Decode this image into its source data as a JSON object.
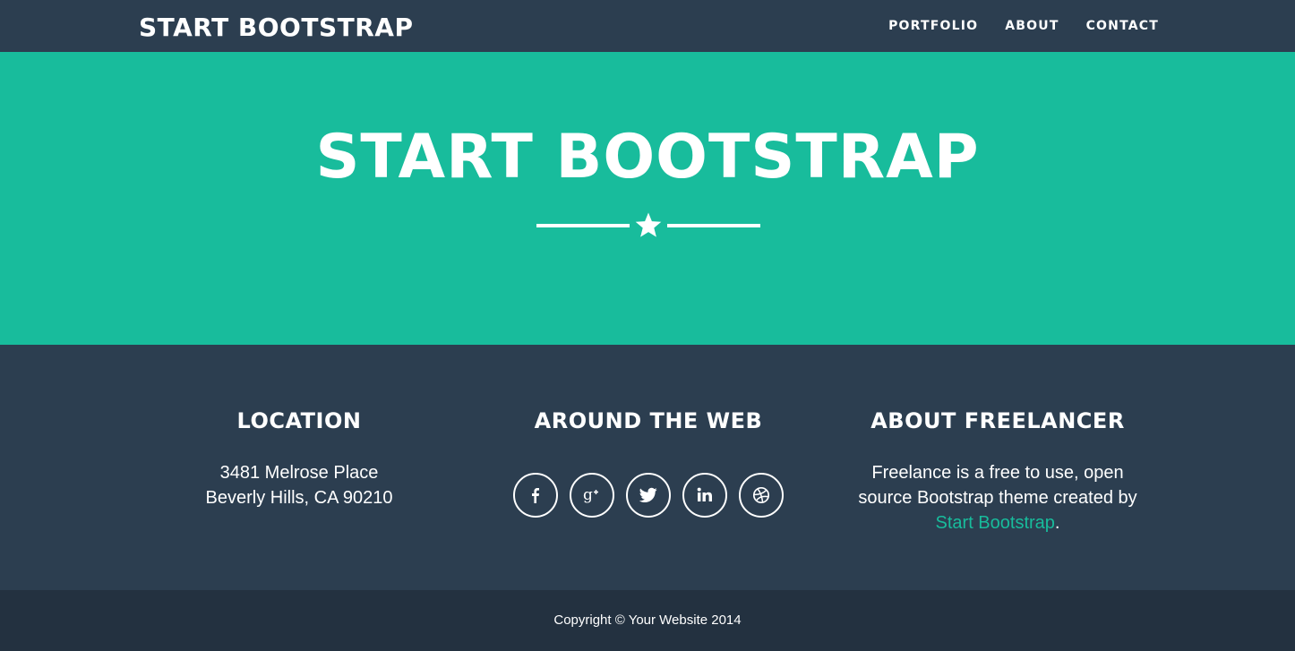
{
  "navbar": {
    "brand": "START BOOTSTRAP",
    "links": [
      "PORTFOLIO",
      "ABOUT",
      "CONTACT"
    ]
  },
  "hero": {
    "title": "START BOOTSTRAP",
    "divider_icon": "star-icon"
  },
  "footer": {
    "location": {
      "heading": "LOCATION",
      "line1": "3481 Melrose Place",
      "line2": "Beverly Hills, CA 90210"
    },
    "web": {
      "heading": "AROUND THE WEB",
      "icons": [
        "facebook-icon",
        "google-plus-icon",
        "twitter-icon",
        "linkedin-icon",
        "dribbble-icon"
      ]
    },
    "about": {
      "heading": "ABOUT FREELANCER",
      "text": "Freelance is a free to use, open source Bootstrap theme created by ",
      "link_text": "Start Bootstrap",
      "suffix": "."
    },
    "copyright": "Copyright © Your Website 2014"
  },
  "colors": {
    "primary": "#2c3e50",
    "accent": "#18bc9c",
    "footer_bottom": "#233140",
    "text": "#ffffff"
  }
}
